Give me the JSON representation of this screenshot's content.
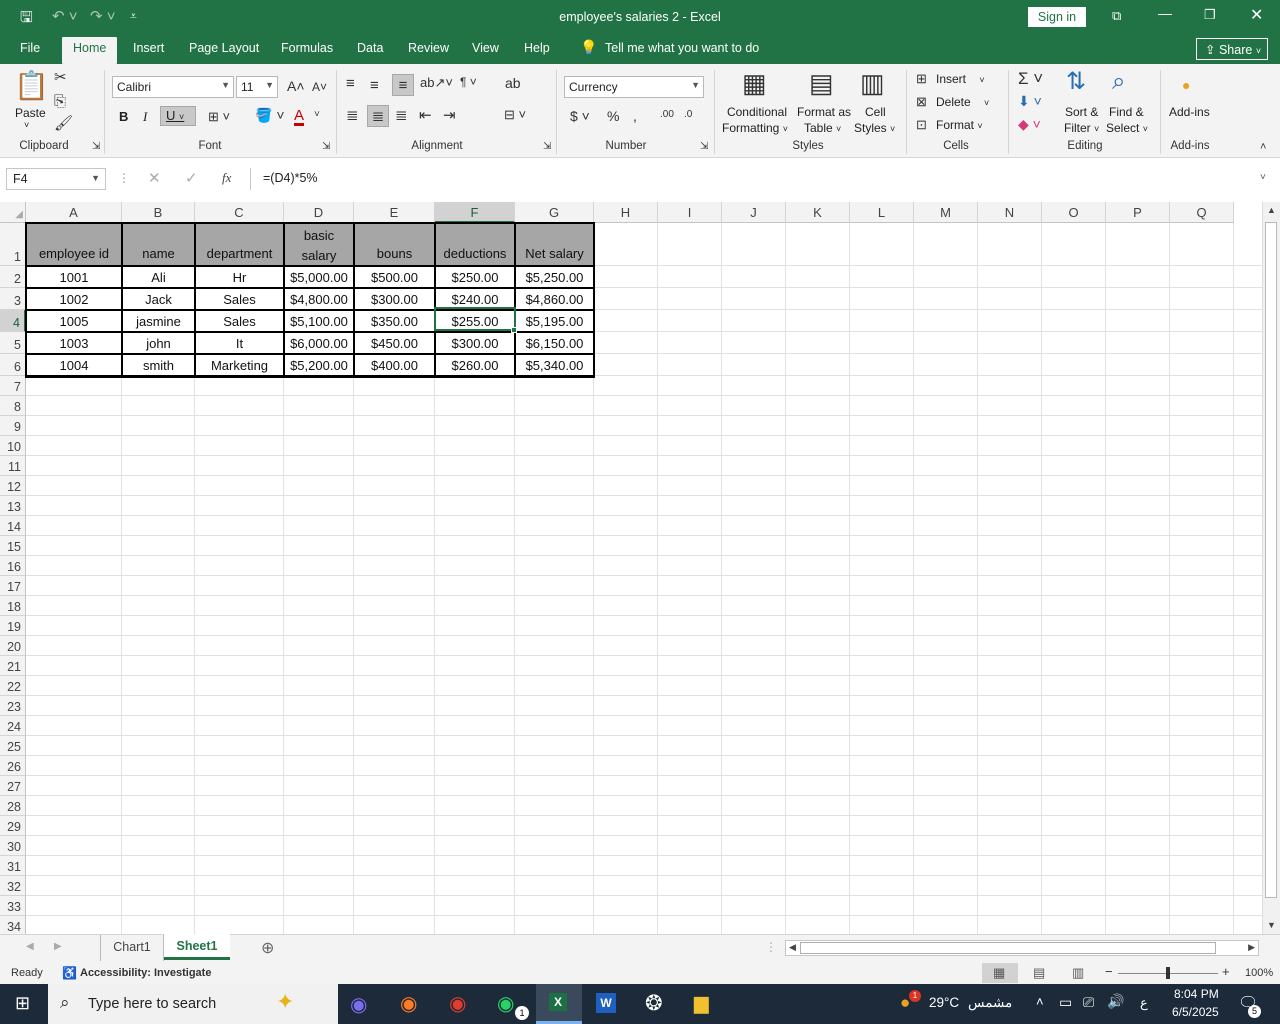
{
  "window": {
    "title": "employee's salaries 2  -  Excel",
    "sign_in": "Sign in",
    "share": "Share"
  },
  "tabs": [
    "File",
    "Home",
    "Insert",
    "Page Layout",
    "Formulas",
    "Data",
    "Review",
    "View",
    "Help"
  ],
  "tell_me": "Tell me what you want to do",
  "ribbon": {
    "clipboard": {
      "paste": "Paste",
      "group": "Clipboard"
    },
    "font": {
      "name": "Calibri",
      "size": "11",
      "bold": "B",
      "italic": "I",
      "underline": "U",
      "group": "Font"
    },
    "alignment": {
      "group": "Alignment"
    },
    "number": {
      "format": "Currency",
      "group": "Number"
    },
    "styles": {
      "conditional": "Conditional",
      "conditional2": "Formatting",
      "format_as": "Format as",
      "format_as2": "Table",
      "cell": "Cell",
      "cell2": "Styles",
      "group": "Styles"
    },
    "cells": {
      "insert": "Insert",
      "delete": "Delete",
      "format": "Format",
      "group": "Cells"
    },
    "editing": {
      "sort": "Sort &",
      "sort2": "Filter",
      "find": "Find &",
      "find2": "Select",
      "group": "Editing"
    },
    "addins": {
      "label": "Add-ins",
      "group": "Add-ins"
    }
  },
  "formula_bar": {
    "name_box": "F4",
    "formula": "=(D4)*5%",
    "fx": "fx"
  },
  "columns": [
    "A",
    "B",
    "C",
    "D",
    "E",
    "F",
    "G",
    "H",
    "I",
    "J",
    "K",
    "L",
    "M",
    "N",
    "O",
    "P",
    "Q"
  ],
  "selected_column": "F",
  "selected_row": 4,
  "rows": [
    "1",
    "2",
    "3",
    "4",
    "5",
    "6",
    "7",
    "8",
    "9",
    "10",
    "11",
    "12",
    "13",
    "14",
    "15",
    "16",
    "17",
    "18",
    "19",
    "20",
    "21",
    "22",
    "23",
    "24",
    "25",
    "26",
    "27",
    "28",
    "29",
    "30",
    "31",
    "32",
    "33",
    "34"
  ],
  "table": {
    "headers": [
      "employee id",
      "name",
      "department",
      "basic salary",
      "bouns",
      "deductions",
      "Net salary"
    ],
    "header_d_lines": [
      "basic",
      "salary"
    ],
    "data": [
      [
        "1001",
        "Ali",
        "Hr",
        "$5,000.00",
        "$500.00",
        "$250.00",
        "$5,250.00"
      ],
      [
        "1002",
        "Jack",
        "Sales",
        "$4,800.00",
        "$300.00",
        "$240.00",
        "$4,860.00"
      ],
      [
        "1005",
        "jasmine",
        "Sales",
        "$5,100.00",
        "$350.00",
        "$255.00",
        "$5,195.00"
      ],
      [
        "1003",
        "john",
        "It",
        "$6,000.00",
        "$450.00",
        "$300.00",
        "$6,150.00"
      ],
      [
        "1004",
        "smith",
        "Marketing",
        "$5,200.00",
        "$400.00",
        "$260.00",
        "$5,340.00"
      ]
    ]
  },
  "sheets": [
    "Chart1",
    "Sheet1"
  ],
  "active_sheet": "Sheet1",
  "status": {
    "ready": "Ready",
    "accessibility": "Accessibility: Investigate",
    "zoom": "100%"
  },
  "taskbar": {
    "search_placeholder": "Type here to search",
    "weather": "29°C",
    "weather_text": "مشمس",
    "lang": "ع",
    "time": "8:04 PM",
    "date": "6/5/2025",
    "notifications": "5",
    "whatsapp_badge": "1",
    "weather_badge": "1"
  },
  "colors": {
    "excel_green": "#217346",
    "header_fill": "#a6a6a6",
    "taskbar": "#1c2a3a"
  }
}
